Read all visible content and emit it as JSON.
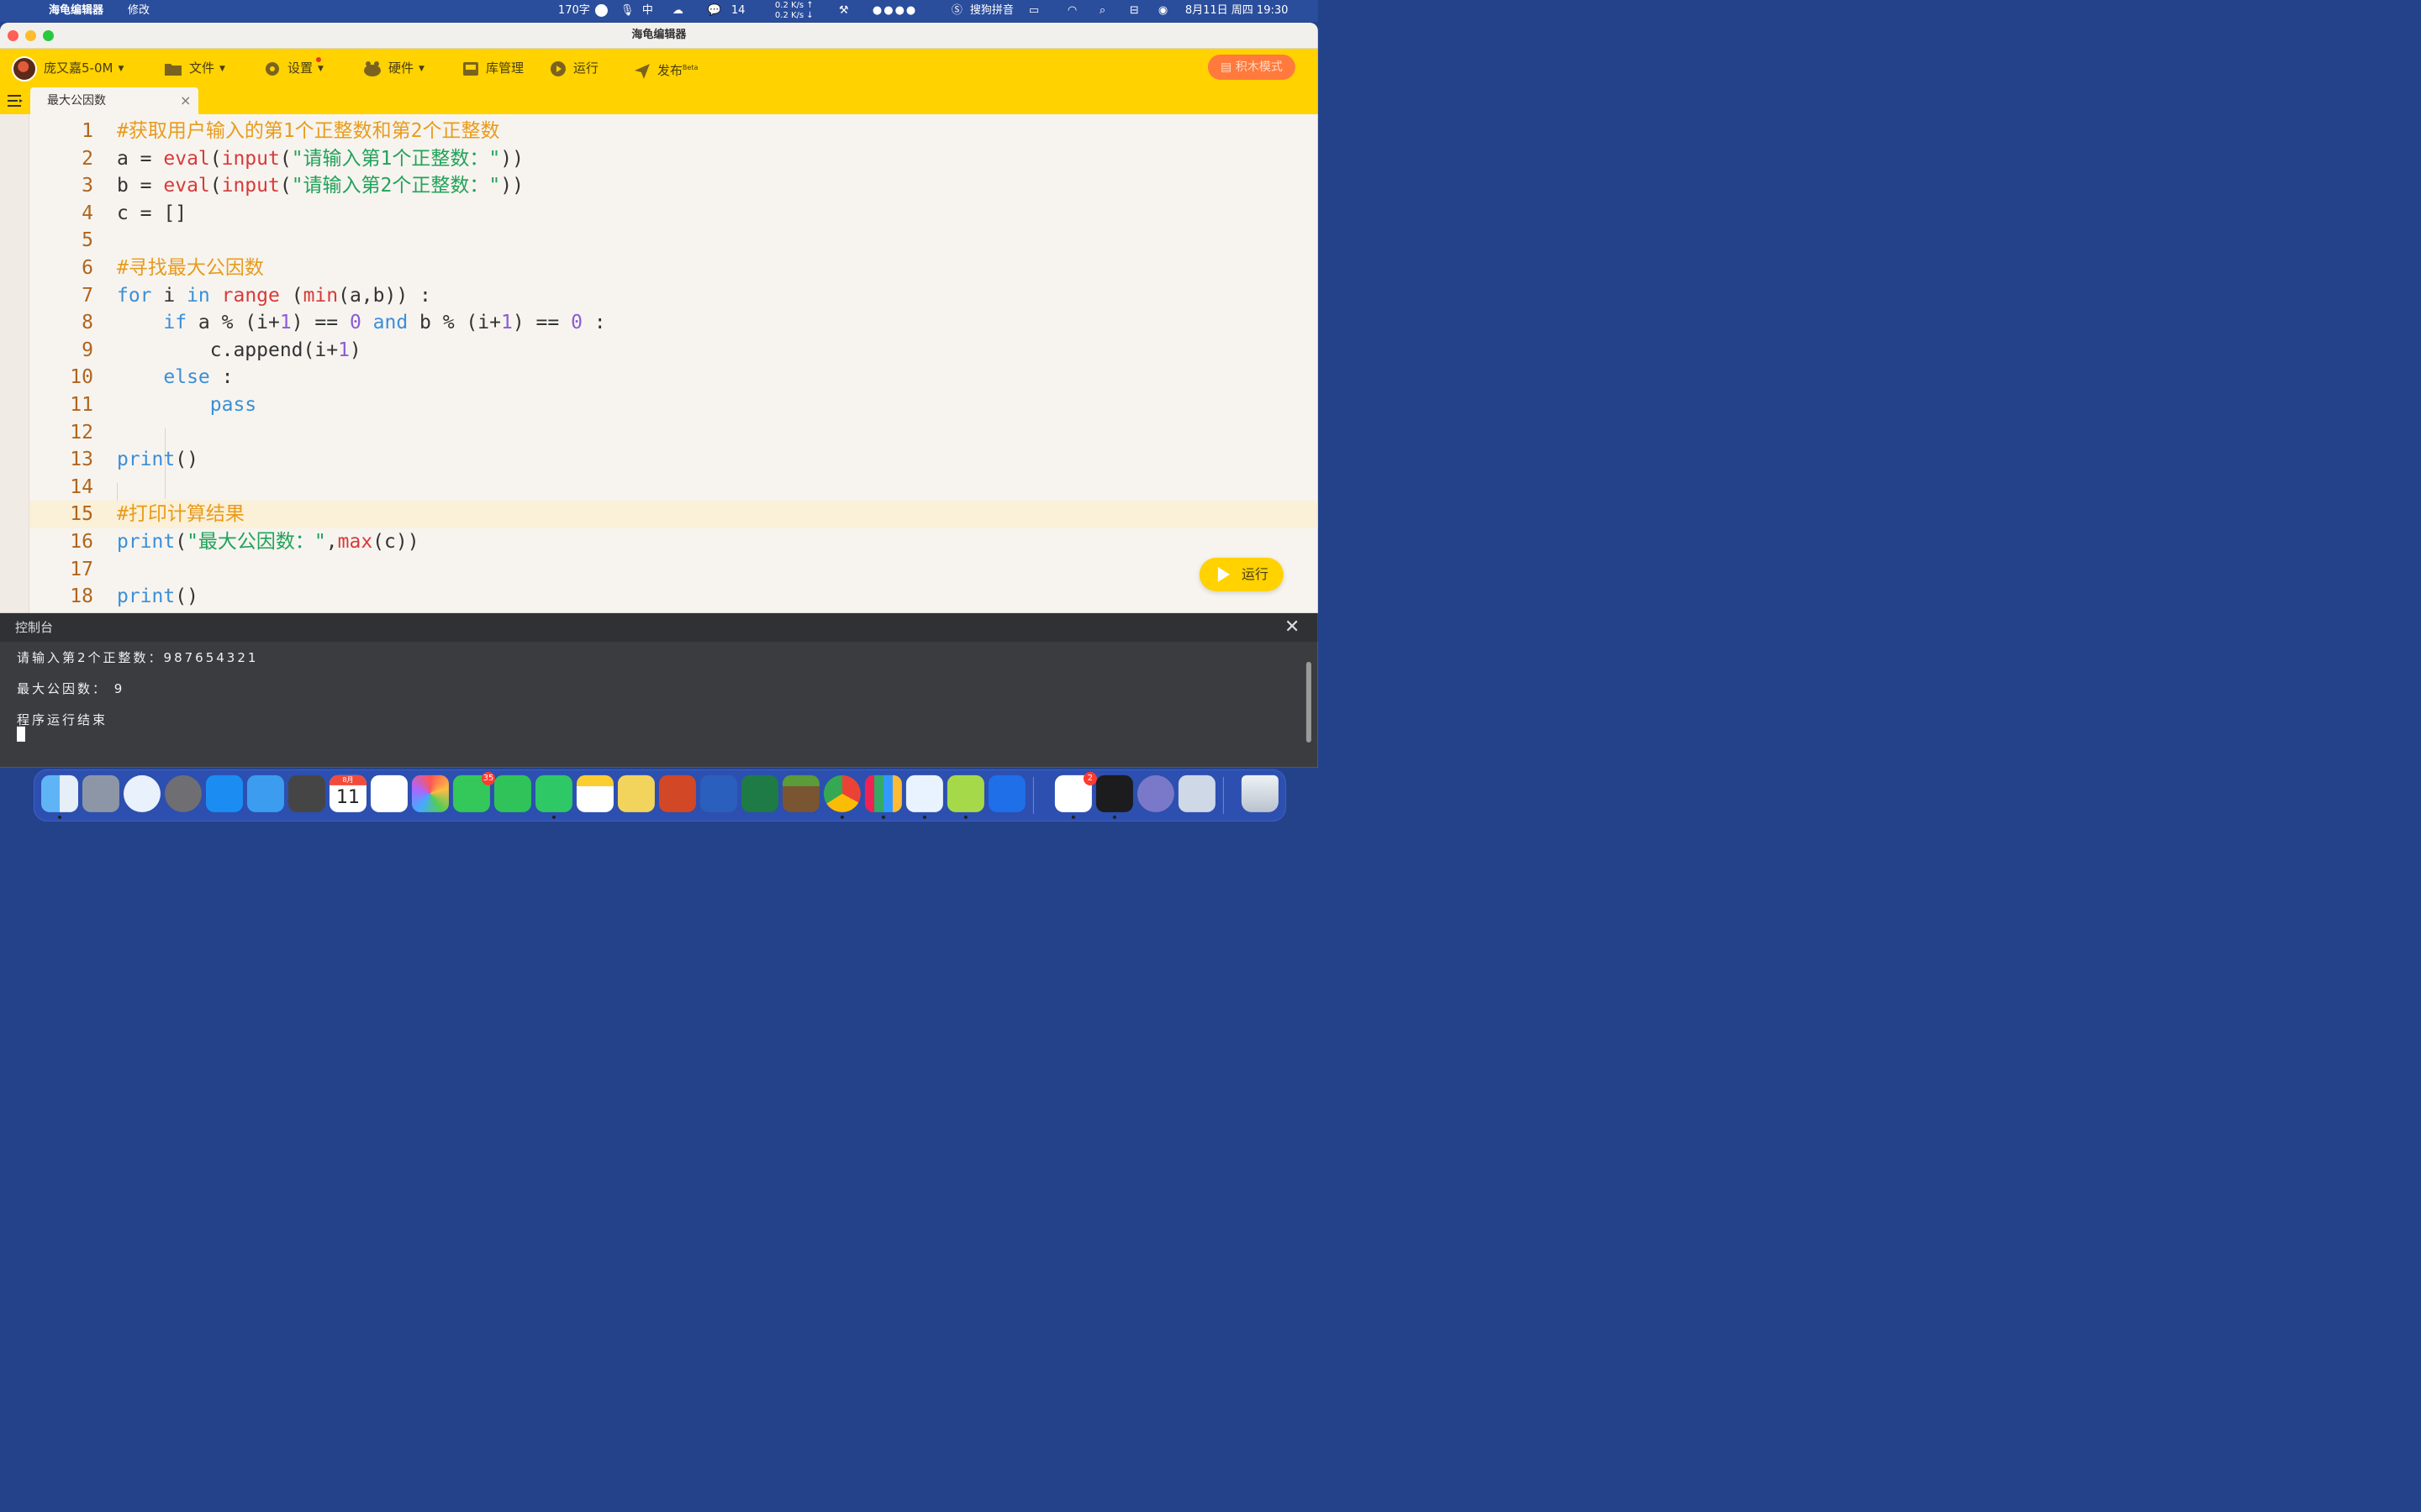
{
  "menubar": {
    "app_name": "海龟编辑器",
    "menu_edit": "修改",
    "word_count": "170字",
    "wechat_count": "14",
    "net_up": "0.2 K/s ↑",
    "net_down": "0.2 K/s ↓",
    "ime": "搜狗拼音",
    "datetime": "8月11日 周四 19:30"
  },
  "window": {
    "title": "海龟编辑器"
  },
  "toolbar": {
    "user": "庞又嘉5-0M",
    "file": "文件",
    "settings": "设置",
    "hardware": "硬件",
    "library": "库管理",
    "run": "运行",
    "publish": "发布",
    "publish_beta": "Beta",
    "blocks_mode": "积木模式"
  },
  "tab": {
    "label": "最大公因数",
    "close": "×"
  },
  "editor": {
    "line_numbers": [
      "1",
      "2",
      "3",
      "4",
      "5",
      "6",
      "7",
      "8",
      "9",
      "10",
      "11",
      "12",
      "13",
      "14",
      "15",
      "16",
      "17",
      "18"
    ],
    "lines": [
      [
        {
          "t": "com",
          "v": "#获取用户输入的第1个正整数和第2个正整数"
        }
      ],
      [
        {
          "t": "txt",
          "v": "a = "
        },
        {
          "t": "fn",
          "v": "eval"
        },
        {
          "t": "txt",
          "v": "("
        },
        {
          "t": "fn",
          "v": "input"
        },
        {
          "t": "txt",
          "v": "("
        },
        {
          "t": "str",
          "v": "\"请输入第1个正整数：\""
        },
        {
          "t": "txt",
          "v": "))"
        }
      ],
      [
        {
          "t": "txt",
          "v": "b = "
        },
        {
          "t": "fn",
          "v": "eval"
        },
        {
          "t": "txt",
          "v": "("
        },
        {
          "t": "fn",
          "v": "input"
        },
        {
          "t": "txt",
          "v": "("
        },
        {
          "t": "str",
          "v": "\"请输入第2个正整数：\""
        },
        {
          "t": "txt",
          "v": "))"
        }
      ],
      [
        {
          "t": "txt",
          "v": "c = []"
        }
      ],
      [],
      [
        {
          "t": "com",
          "v": "#寻找最大公因数"
        }
      ],
      [
        {
          "t": "kw",
          "v": "for"
        },
        {
          "t": "txt",
          "v": " i "
        },
        {
          "t": "kw",
          "v": "in"
        },
        {
          "t": "txt",
          "v": " "
        },
        {
          "t": "fn",
          "v": "range"
        },
        {
          "t": "txt",
          "v": " ("
        },
        {
          "t": "fn",
          "v": "min"
        },
        {
          "t": "txt",
          "v": "(a,b)) :"
        }
      ],
      [
        {
          "t": "txt",
          "v": "    "
        },
        {
          "t": "kw",
          "v": "if"
        },
        {
          "t": "txt",
          "v": " a % (i+"
        },
        {
          "t": "num",
          "v": "1"
        },
        {
          "t": "txt",
          "v": ") == "
        },
        {
          "t": "num",
          "v": "0"
        },
        {
          "t": "txt",
          "v": " "
        },
        {
          "t": "kw",
          "v": "and"
        },
        {
          "t": "txt",
          "v": " b % (i+"
        },
        {
          "t": "num",
          "v": "1"
        },
        {
          "t": "txt",
          "v": ") == "
        },
        {
          "t": "num",
          "v": "0"
        },
        {
          "t": "txt",
          "v": " :"
        }
      ],
      [
        {
          "t": "txt",
          "v": "        c.append(i+"
        },
        {
          "t": "num",
          "v": "1"
        },
        {
          "t": "txt",
          "v": ")"
        }
      ],
      [
        {
          "t": "txt",
          "v": "    "
        },
        {
          "t": "kw",
          "v": "else"
        },
        {
          "t": "txt",
          "v": " :"
        }
      ],
      [
        {
          "t": "txt",
          "v": "        "
        },
        {
          "t": "kw",
          "v": "pass"
        }
      ],
      [],
      [
        {
          "t": "kw",
          "v": "print"
        },
        {
          "t": "txt",
          "v": "()"
        }
      ],
      [],
      [
        {
          "t": "com",
          "v": "#打印计算结果"
        }
      ],
      [
        {
          "t": "kw",
          "v": "print"
        },
        {
          "t": "txt",
          "v": "("
        },
        {
          "t": "str",
          "v": "\"最大公因数：\""
        },
        {
          "t": "txt",
          "v": ","
        },
        {
          "t": "fn",
          "v": "max"
        },
        {
          "t": "txt",
          "v": "(c))"
        }
      ],
      [],
      [
        {
          "t": "kw",
          "v": "print"
        },
        {
          "t": "txt",
          "v": "()"
        }
      ]
    ],
    "highlighted_line": 15,
    "run_button": "运行"
  },
  "console": {
    "title": "控制台",
    "close": "✕",
    "lines": [
      "请输入第2个正整数：987654321",
      "最大公因数： 9",
      "程序运行结束"
    ]
  },
  "dock": {
    "messages_badge": "35",
    "calendar_month": "8月",
    "calendar_day": "11",
    "store_badge": "2"
  },
  "colors": {
    "toolbar_bg": "#ffd200",
    "editor_bg": "#f7f4ef",
    "console_bg": "#3a3c3f",
    "comment": "#e89b1c",
    "keyword": "#3a8fd8",
    "function": "#d83a3a",
    "string": "#22a25a",
    "number": "#8a5cd6"
  }
}
